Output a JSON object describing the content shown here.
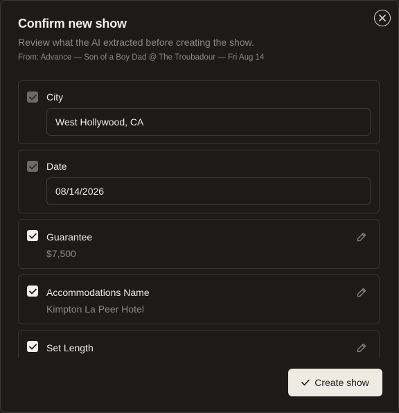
{
  "modal": {
    "title": "Confirm new show",
    "subtitle": "Review what the AI extracted before creating the show.",
    "source": "From: Advance — Son of a Boy Dad @ The Troubadour — Fri Aug 14"
  },
  "fields": [
    {
      "label": "City",
      "value": "West Hollywood, CA",
      "checked": true,
      "locked": true
    },
    {
      "label": "Date",
      "value": "08/14/2026",
      "checked": true,
      "locked": true
    },
    {
      "label": "Guarantee",
      "value": "$7,500",
      "checked": true,
      "locked": false
    },
    {
      "label": "Accommodations Name",
      "value": "Kimpton La Peer Hotel",
      "checked": true,
      "locked": false
    },
    {
      "label": "Set Length",
      "value": "",
      "checked": true,
      "locked": false
    }
  ],
  "actions": {
    "create_label": "Create show"
  },
  "icons": {
    "close": "close-icon",
    "check": "check-icon",
    "edit": "pencil-icon"
  },
  "colors": {
    "background": "#1c1b19",
    "border": "#353431",
    "text": "#ecebe6",
    "muted": "#8d8a84",
    "button": "#efebe3"
  }
}
